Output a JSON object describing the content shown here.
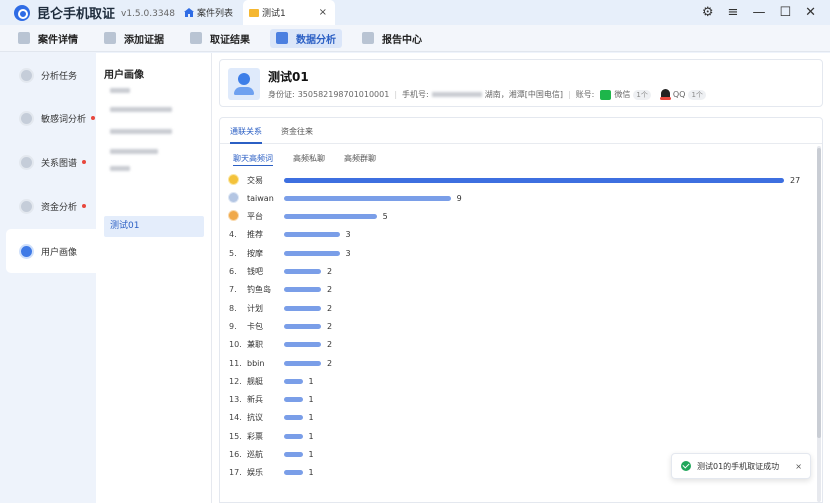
{
  "app": {
    "name": "昆仑手机取证",
    "version": "v1.5.0.3348",
    "home_tab": "案件列表",
    "active_tab": "测试1",
    "tab_close": "×",
    "controls": [
      "⚙",
      "≡",
      "—",
      "☐",
      "✕"
    ]
  },
  "toolbar": {
    "items": [
      {
        "label": "案件详情",
        "icon": "case-detail-icon",
        "active": false
      },
      {
        "label": "添加证据",
        "icon": "add-evidence-icon",
        "active": false
      },
      {
        "label": "取证结果",
        "icon": "forensic-result-icon",
        "active": false
      },
      {
        "label": "数据分析",
        "icon": "data-analysis-icon",
        "active": true
      },
      {
        "label": "报告中心",
        "icon": "report-center-icon",
        "active": false
      }
    ]
  },
  "leftnav": {
    "items": [
      {
        "label": "分析任务",
        "dot": false,
        "active": false
      },
      {
        "label": "敏感词分析",
        "dot": true,
        "active": false
      },
      {
        "label": "关系图谱",
        "dot": true,
        "active": false
      },
      {
        "label": "资金分析",
        "dot": true,
        "active": false
      },
      {
        "label": "用户画像",
        "dot": false,
        "active": true
      }
    ]
  },
  "userlist": {
    "title": "用户画像",
    "selected": "测试01"
  },
  "profile": {
    "name": "测试01",
    "id_label": "身份证:",
    "id_value": "350582198701010001",
    "phone_label": "手机号:",
    "phone_location": "湖南，湘潭[中国电信]",
    "account_label": "账号:",
    "accounts": [
      {
        "name": "微信",
        "count": "1个"
      },
      {
        "name": "QQ",
        "count": "1个"
      }
    ]
  },
  "tabs": {
    "main": [
      "通联关系",
      "资金往来"
    ],
    "sub": [
      "聊天高频词",
      "高频私聊",
      "高频群聊"
    ]
  },
  "colors": {
    "accent": "#2b5fc4",
    "bar_top": "#3d6fe0",
    "bar_other": "#7a9ee8"
  },
  "chart_data": {
    "type": "bar",
    "orientation": "horizontal",
    "max": 27,
    "rows": [
      {
        "rank": "",
        "word": "交易",
        "value": 27,
        "medal": "gold"
      },
      {
        "rank": "",
        "word": "taiwan",
        "value": 9,
        "medal": "silver"
      },
      {
        "rank": "",
        "word": "平台",
        "value": 5,
        "medal": "bronze"
      },
      {
        "rank": "4.",
        "word": "推荐",
        "value": 3
      },
      {
        "rank": "5.",
        "word": "按摩",
        "value": 3
      },
      {
        "rank": "6.",
        "word": "钱吧",
        "value": 2
      },
      {
        "rank": "7.",
        "word": "钓鱼岛",
        "value": 2
      },
      {
        "rank": "8.",
        "word": "计划",
        "value": 2
      },
      {
        "rank": "9.",
        "word": "卡包",
        "value": 2
      },
      {
        "rank": "10.",
        "word": "兼职",
        "value": 2
      },
      {
        "rank": "11.",
        "word": "bbin",
        "value": 2
      },
      {
        "rank": "12.",
        "word": "舰艇",
        "value": 1
      },
      {
        "rank": "13.",
        "word": "新兵",
        "value": 1
      },
      {
        "rank": "14.",
        "word": "抗议",
        "value": 1
      },
      {
        "rank": "15.",
        "word": "彩票",
        "value": 1
      },
      {
        "rank": "16.",
        "word": "巡航",
        "value": 1
      },
      {
        "rank": "17.",
        "word": "娱乐",
        "value": 1
      }
    ]
  },
  "toast": {
    "message": "测试01的手机取证成功",
    "close": "×"
  }
}
